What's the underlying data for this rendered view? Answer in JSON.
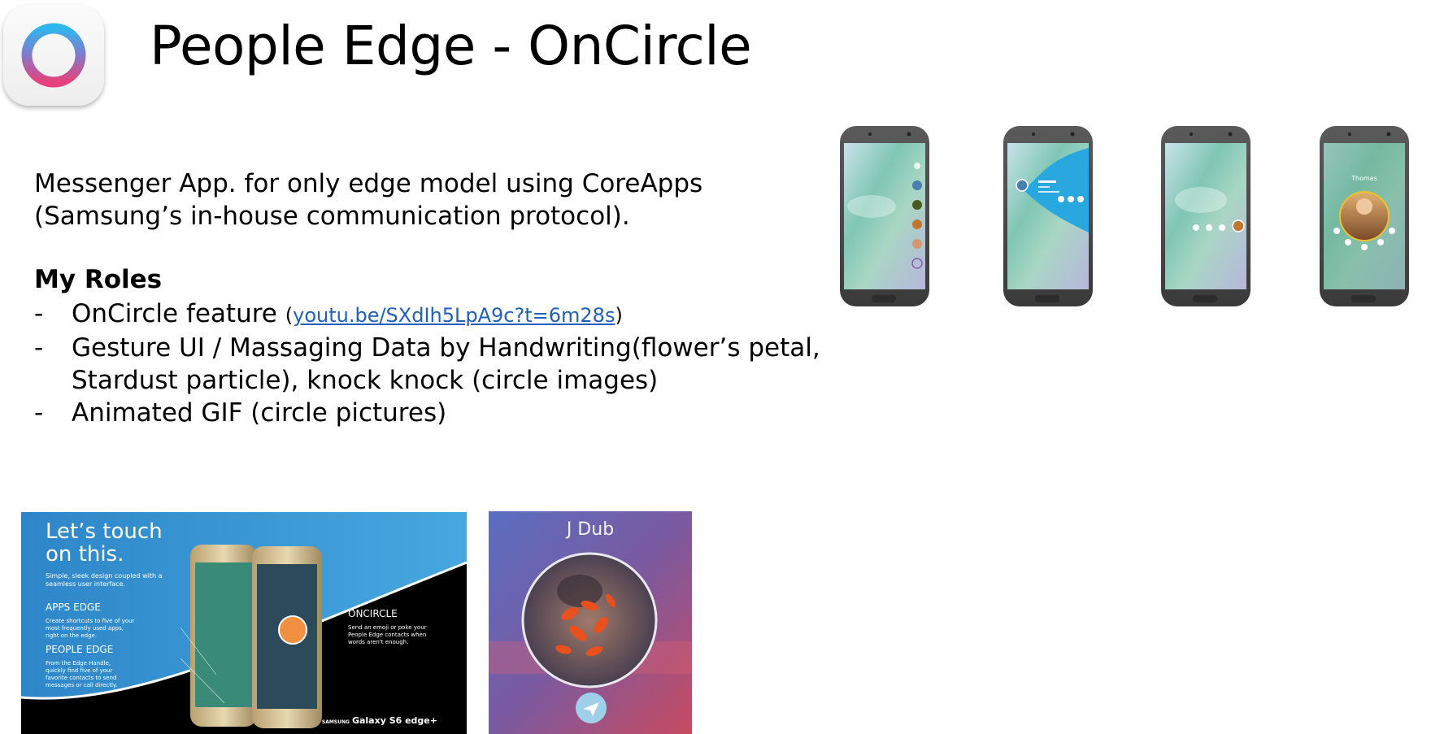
{
  "slide": {
    "title": "People Edge - OnCircle",
    "description": [
      "Messenger App. for only edge model using CoreApps",
      "(Samsung’s in-house communication protocol)."
    ],
    "roles_heading": "My Roles",
    "roles": [
      {
        "bullet": "-",
        "text": "OnCircle feature",
        "link_open": "(",
        "link": "youtu.be/SXdIh5LpA9c?t=6m28s",
        "link_close": ")"
      },
      {
        "bullet": "-",
        "text": "Gesture UI / Massaging Data by Handwriting(flower’s petal,",
        "continuation": "Stardust particle), knock knock (circle images)"
      },
      {
        "bullet": "-",
        "text": "Animated GIF (circle pictures)"
      }
    ]
  },
  "phones": {
    "phone4_contact_name": "Thomas"
  },
  "promo": {
    "headline": [
      "Let’s touch",
      "on this."
    ],
    "subtitle": "Simple, sleek design coupled with a seamless user interface.",
    "apps_edge_title": "APPS EDGE",
    "apps_edge_text": "Create shortcuts to five of your most frequently used apps, right on the edge.",
    "people_edge_title": "PEOPLE EDGE",
    "people_edge_text": "From the Edge Handle, quickly find five of your favorite contacts to send messages or call directly.",
    "oncircle_title": "ONCIRCLE",
    "oncircle_text": "Send an emoji or poke your People Edge contacts when words aren't enough.",
    "brand": "Galaxy S6 edge+",
    "brand_prefix": "SAMSUNG"
  },
  "jdub": {
    "name": "J Dub"
  },
  "colors": {
    "link": "#1f5fbf",
    "edge_blue": "#29a8e0",
    "ring_gradient_start": "#2fb6ee",
    "ring_gradient_end": "#e8407a"
  }
}
